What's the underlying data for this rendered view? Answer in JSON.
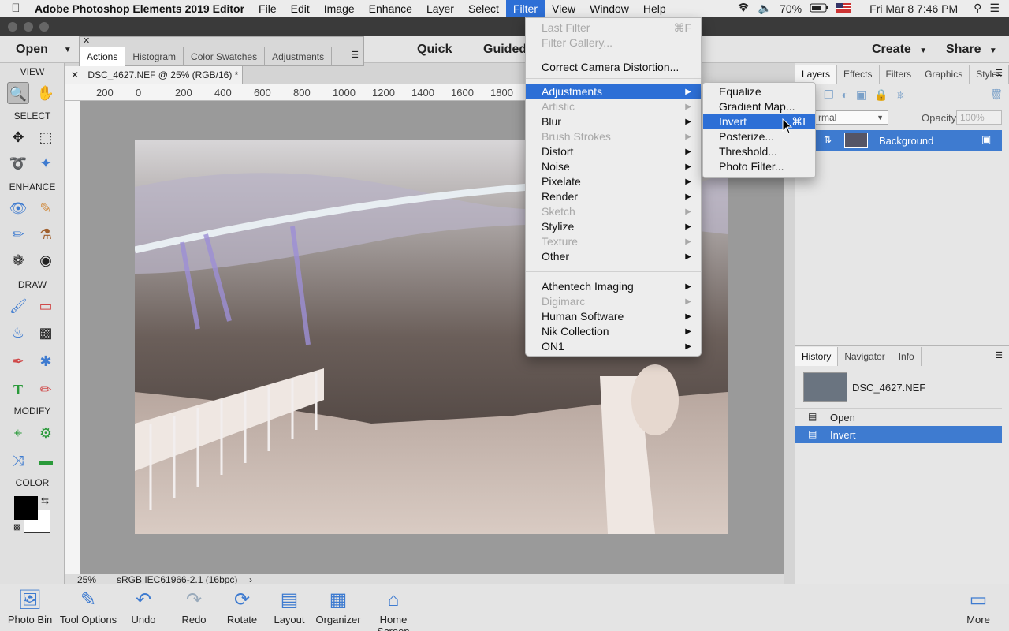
{
  "menubar": {
    "app_name": "Adobe Photoshop Elements 2019 Editor",
    "items": [
      "File",
      "Edit",
      "Image",
      "Enhance",
      "Layer",
      "Select",
      "Filter",
      "View",
      "Window",
      "Help"
    ],
    "active_item": "Filter",
    "battery": "70%",
    "clock": "Fri Mar 8  7:46 PM"
  },
  "topbar": {
    "open_label": "Open",
    "modes": [
      "Quick",
      "Guided"
    ],
    "create_label": "Create",
    "share_label": "Share"
  },
  "float_panel": {
    "tabs": [
      "Actions",
      "Histogram",
      "Color Swatches",
      "Adjustments"
    ],
    "active_tab": "Actions"
  },
  "toolbox": {
    "sections": [
      "VIEW",
      "SELECT",
      "ENHANCE",
      "DRAW",
      "MODIFY",
      "COLOR"
    ]
  },
  "document": {
    "tab_title": "DSC_4627.NEF @ 25% (RGB/16) *",
    "ruler_ticks": [
      "200",
      "0",
      "200",
      "400",
      "600",
      "800",
      "1000",
      "1200",
      "1400",
      "1600",
      "1800"
    ],
    "zoom": "25%",
    "profile": "sRGB IEC61966-2.1 (16bpc)"
  },
  "filter_menu": {
    "items": [
      {
        "label": "Last Filter",
        "shortcut": "⌘F",
        "disabled": true
      },
      {
        "label": "Filter Gallery...",
        "disabled": true
      },
      {
        "label": "Correct Camera Distortion..."
      },
      {
        "label": "Adjustments",
        "submenu": true,
        "highlight": true
      },
      {
        "label": "Artistic",
        "submenu": true,
        "disabled": true
      },
      {
        "label": "Blur",
        "submenu": true
      },
      {
        "label": "Brush Strokes",
        "submenu": true,
        "disabled": true
      },
      {
        "label": "Distort",
        "submenu": true
      },
      {
        "label": "Noise",
        "submenu": true
      },
      {
        "label": "Pixelate",
        "submenu": true
      },
      {
        "label": "Render",
        "submenu": true
      },
      {
        "label": "Sketch",
        "submenu": true,
        "disabled": true
      },
      {
        "label": "Stylize",
        "submenu": true
      },
      {
        "label": "Texture",
        "submenu": true,
        "disabled": true
      },
      {
        "label": "Other",
        "submenu": true
      },
      {
        "label": "Athentech Imaging",
        "submenu": true
      },
      {
        "label": "Digimarc",
        "submenu": true,
        "disabled": true
      },
      {
        "label": "Human Software",
        "submenu": true
      },
      {
        "label": "Nik Collection",
        "submenu": true
      },
      {
        "label": "ON1",
        "submenu": true
      }
    ]
  },
  "adjustments_submenu": {
    "items": [
      {
        "label": "Equalize"
      },
      {
        "label": "Gradient Map..."
      },
      {
        "label": "Invert",
        "shortcut": "⌘I",
        "highlight": true
      },
      {
        "label": "Posterize..."
      },
      {
        "label": "Threshold..."
      },
      {
        "label": "Photo Filter..."
      }
    ]
  },
  "layers_panel": {
    "tabs": [
      "Layers",
      "Effects",
      "Filters",
      "Graphics",
      "Styles"
    ],
    "active_tab": "Layers",
    "blend_mode": "rmal",
    "opacity_label": "Opacity:",
    "opacity_value": "100%",
    "layer_name": "Background"
  },
  "history_panel": {
    "tabs": [
      "History",
      "Navigator",
      "Info"
    ],
    "active_tab": "History",
    "snapshot": "DSC_4627.NEF",
    "states": [
      "Open",
      "Invert"
    ],
    "selected_state": "Invert"
  },
  "bottombar": {
    "buttons": [
      "Photo Bin",
      "Tool Options",
      "Undo",
      "Redo",
      "Rotate",
      "Layout",
      "Organizer",
      "Home Screen"
    ],
    "more_label": "More"
  }
}
